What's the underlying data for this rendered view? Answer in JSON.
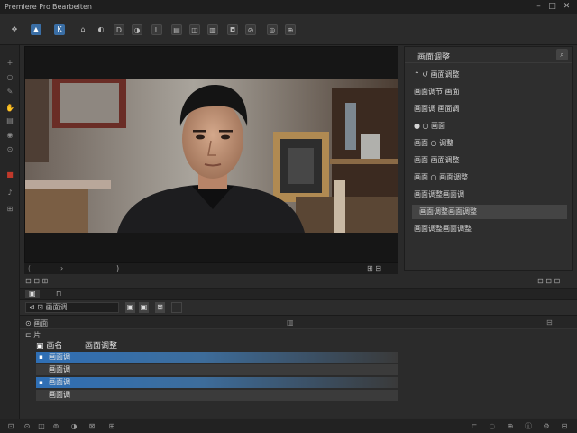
{
  "app": {
    "title": "Premiere Pro",
    "subtitle": "Bearbeiten"
  },
  "window_controls": {
    "minimize": "–",
    "maximize": "□",
    "close": "✕"
  },
  "toolbar": {
    "buttons": [
      {
        "icon": "move-icon",
        "glyph": "✥"
      },
      {
        "icon": "select-icon",
        "glyph": "▲"
      },
      {
        "icon": "text-icon",
        "glyph": "K"
      },
      {
        "icon": "brush-icon",
        "glyph": "⌂"
      },
      {
        "icon": "crop-icon",
        "glyph": "◐"
      },
      {
        "icon": "track-icon",
        "glyph": "D"
      },
      {
        "icon": "razor-icon",
        "glyph": "◑"
      },
      {
        "icon": "ripple-icon",
        "glyph": "L"
      },
      {
        "icon": "slip-icon",
        "glyph": "▤"
      },
      {
        "icon": "pen-icon",
        "glyph": "◫"
      },
      {
        "icon": "hand-icon",
        "glyph": "▥"
      },
      {
        "icon": "zoom-icon",
        "glyph": "◘"
      },
      {
        "icon": "link-icon",
        "glyph": "⊘"
      },
      {
        "icon": "marker-icon",
        "glyph": "◎"
      },
      {
        "icon": "export-icon",
        "glyph": "⊕"
      }
    ]
  },
  "sidebar": {
    "icons": [
      "add-icon",
      "circle-icon",
      "pencil-icon",
      "hand-icon",
      "layers-icon",
      "eye-icon",
      "lock-icon",
      "record-icon",
      "audio-icon",
      "grid-icon"
    ]
  },
  "right_panel": {
    "title": "画面调整",
    "search_icon": "search-icon",
    "items": [
      {
        "label": "↑ ↺ 画面调整"
      },
      {
        "label": "画面调节 画面"
      },
      {
        "label": "画面调 画面调"
      },
      {
        "label": "● ○ 画面"
      },
      {
        "label": "画面 ○ 调整"
      },
      {
        "label": "画面 画面调整"
      },
      {
        "label": "画面 ○ 画面调整"
      },
      {
        "label": "画面调整画面调"
      },
      {
        "label": "画面调整画面调整",
        "selected": true
      },
      {
        "label": "画面调整画面调整"
      }
    ]
  },
  "transport": {
    "marks": [
      "(",
      ")",
      "›"
    ],
    "timecode": "⊞ ⊟"
  },
  "status_row": {
    "left": "⊡ ⊡ ⊞",
    "right": "⊡ ⊡ ⊡"
  },
  "tabs": [
    {
      "label": "▣"
    },
    {
      "label": "⊓"
    }
  ],
  "panel_toolbar": {
    "label": "⊲ ⊡ 画面调",
    "tools": [
      "▣",
      "▣",
      "⊠"
    ]
  },
  "list_header": {
    "label": "⊙ 画面",
    "count": "▥"
  },
  "list": {
    "section": "⊏ 片",
    "columns": [
      "画名",
      "画面调整"
    ],
    "rows": [
      {
        "label": "画面调",
        "checked": true
      },
      {
        "label": "画面调",
        "checked": false
      },
      {
        "label": "画面调",
        "checked": true
      },
      {
        "label": "画面调",
        "checked": false
      }
    ]
  },
  "colors": {
    "accent": "#2f6fb5",
    "row_highlight": "#3d6d9c",
    "bg": "#2a2a2a"
  }
}
